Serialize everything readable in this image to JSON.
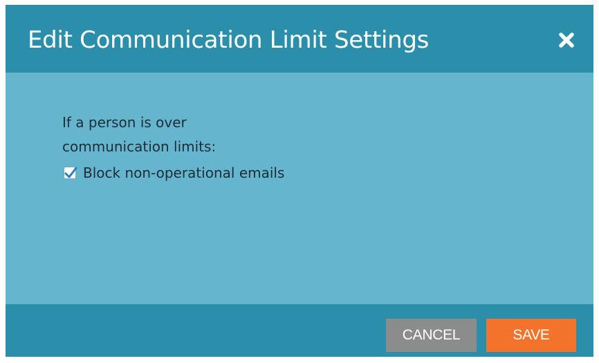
{
  "dialog": {
    "title": "Edit Communication Limit Settings",
    "close_icon": "close-icon",
    "prompt_line1": "If a person is over",
    "prompt_line2": "communication limits:",
    "checkbox": {
      "label": "Block non-operational emails",
      "checked": true,
      "icon": "checkmark-icon"
    },
    "buttons": {
      "cancel_label": "CANCEL",
      "save_label": "SAVE"
    },
    "colors": {
      "header_bar": "#2b8fab",
      "body_background": "#66b5cf",
      "cancel_button": "#8c8c8c",
      "save_button": "#f3722c",
      "checkmark": "#2a7fbd"
    }
  }
}
